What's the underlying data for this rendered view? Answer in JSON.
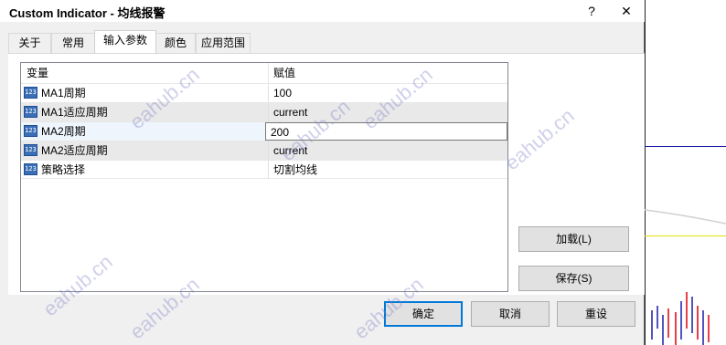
{
  "window": {
    "title": "Custom Indicator - 均线报警",
    "help_icon": "?",
    "close_icon": "✕"
  },
  "tabs": [
    {
      "label": "关于"
    },
    {
      "label": "常用"
    },
    {
      "label": "输入参数"
    },
    {
      "label": "颜色"
    },
    {
      "label": "应用范围"
    }
  ],
  "grid": {
    "col_variable": "变量",
    "col_value": "赋值",
    "type_icon_text": "123",
    "rows": [
      {
        "name": "MA1周期",
        "value": "100"
      },
      {
        "name": "MA1适应周期",
        "value": "current"
      },
      {
        "name": "MA2周期",
        "value": "200"
      },
      {
        "name": "MA2适应周期",
        "value": "current"
      },
      {
        "name": "策略选择",
        "value": "切割均线"
      }
    ]
  },
  "side_buttons": {
    "load": "加载(L)",
    "save": "保存(S)"
  },
  "bottom_buttons": {
    "ok": "确定",
    "cancel": "取消",
    "reset": "重设"
  },
  "watermark": "eahub.cn",
  "colors": {
    "accent": "#0078d7",
    "chart_blue_line": "#1a1aa8",
    "chart_yellow_line": "#e0e000"
  }
}
